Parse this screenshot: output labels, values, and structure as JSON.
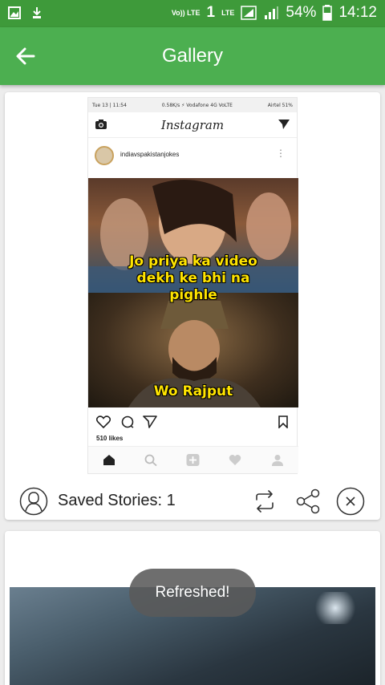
{
  "status_bar": {
    "volte": "Vo)) LTE",
    "sim": "1",
    "lte": "LTE",
    "battery": "54%",
    "time": "14:12"
  },
  "app_bar": {
    "title": "Gallery"
  },
  "story": {
    "instagram": {
      "status_left": "Tue 13 | 11:54",
      "status_mid": "0.58K/s ⚡ Vodafone 4G VoLTE",
      "status_right": "Airtel 51%",
      "logo": "Instagram",
      "username": "indiavspakistanjokes",
      "caption_top": "Jo priya ka video dekh ke bhi na pighle",
      "caption_bottom": "Wo Rajput",
      "likes": "510 likes"
    },
    "saved_stories": "Saved Stories: 1"
  },
  "toast": "Refreshed!",
  "colors": {
    "status_bar": "#3e9a3a",
    "app_bar": "#4caf50",
    "meme_caption": "#ffe400"
  },
  "icons": [
    "back-arrow-icon",
    "repost-icon",
    "share-icon",
    "close-icon",
    "avatar-icon"
  ]
}
